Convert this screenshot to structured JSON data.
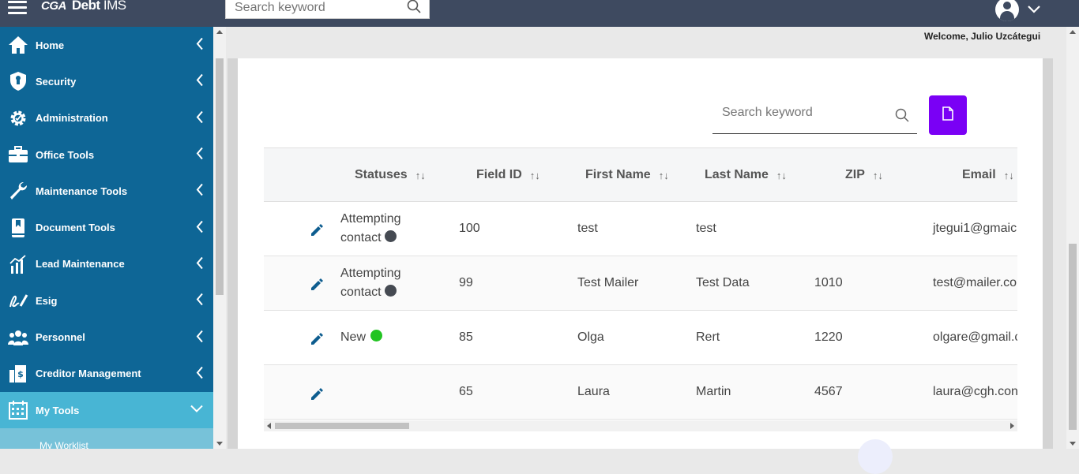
{
  "app": {
    "logo_mark": "CGA",
    "title_bold": "Debt",
    "title_light": "IMS",
    "brand_color": "#3e4a60"
  },
  "top_search": {
    "placeholder": "Search keyword"
  },
  "welcome_text": "Welcome, Julio Uzcátegui",
  "sidebar": {
    "bg_color": "#0e6696",
    "active_color": "#48b5d4",
    "items": [
      {
        "label": "Home",
        "icon": "home-icon"
      },
      {
        "label": "Security",
        "icon": "shield-icon"
      },
      {
        "label": "Administration",
        "icon": "gear-icon"
      },
      {
        "label": "Office Tools",
        "icon": "briefcase-icon"
      },
      {
        "label": "Maintenance Tools",
        "icon": "wrench-icon"
      },
      {
        "label": "Document Tools",
        "icon": "book-icon"
      },
      {
        "label": "Lead Maintenance",
        "icon": "bar-chart-icon"
      },
      {
        "label": "Esig",
        "icon": "signature-icon"
      },
      {
        "label": "Personnel",
        "icon": "people-icon"
      },
      {
        "label": "Creditor Management",
        "icon": "building-dollar-icon"
      },
      {
        "label": "My Tools",
        "icon": "calendar-icon",
        "expanded": true
      }
    ],
    "sub_items": [
      {
        "label": "My Worklist"
      }
    ]
  },
  "table_search": {
    "placeholder": "Search keyword"
  },
  "export_button": {
    "icon": "file-icon",
    "color": "#7a00f5"
  },
  "table": {
    "columns": [
      "Statuses",
      "Field ID",
      "First Name",
      "Last Name",
      "ZIP",
      "Email"
    ],
    "rows": [
      {
        "status_line1": "Attempting",
        "status_line2": "contact",
        "status_color": "#454a52",
        "field_id": "100",
        "first_name": "test",
        "last_name": "test",
        "zip": "",
        "email": "jtegui1@gmaic"
      },
      {
        "status_line1": "Attempting",
        "status_line2": "contact",
        "status_color": "#454a52",
        "field_id": "99",
        "first_name": "Test Mailer",
        "last_name": "Test Data",
        "zip": "1010",
        "email": "test@mailer.co"
      },
      {
        "status_line1": "New",
        "status_line2": "",
        "status_color": "#22c422",
        "field_id": "85",
        "first_name": "Olga",
        "last_name": "Rert",
        "zip": "1220",
        "email": "olgare@gmail.c"
      },
      {
        "status_line1": "",
        "status_line2": "",
        "status_color": "",
        "field_id": "65",
        "first_name": "Laura",
        "last_name": "Martin",
        "zip": "4567",
        "email": "laura@cgh.con"
      }
    ]
  }
}
